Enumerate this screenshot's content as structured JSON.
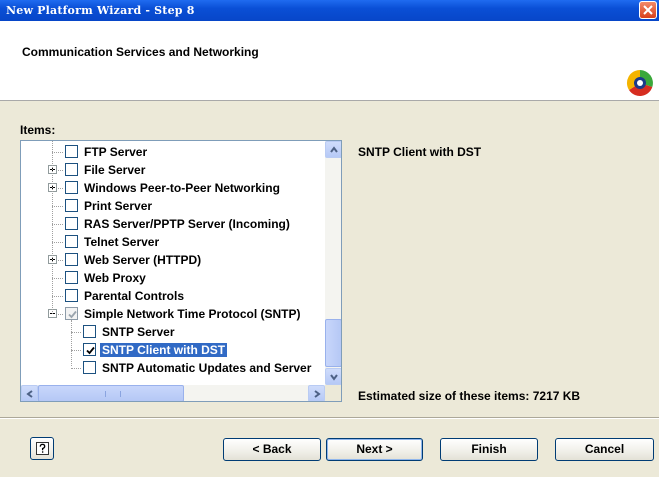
{
  "window": {
    "title": "New Platform Wizard - Step 8"
  },
  "header": {
    "heading": "Communication Services and Networking"
  },
  "items_label": "Items:",
  "tree": [
    {
      "label": "FTP Server",
      "checked": false,
      "expander": null
    },
    {
      "label": "File Server",
      "checked": false,
      "expander": "plus"
    },
    {
      "label": "Windows Peer-to-Peer Networking",
      "checked": false,
      "expander": "plus"
    },
    {
      "label": "Print Server",
      "checked": false,
      "expander": null
    },
    {
      "label": "RAS Server/PPTP Server (Incoming)",
      "checked": false,
      "expander": null
    },
    {
      "label": "Telnet Server",
      "checked": false,
      "expander": null
    },
    {
      "label": "Web Server (HTTPD)",
      "checked": false,
      "expander": "plus"
    },
    {
      "label": "Web Proxy",
      "checked": false,
      "expander": null
    },
    {
      "label": "Parental Controls",
      "checked": false,
      "expander": null
    },
    {
      "label": "Simple Network Time Protocol (SNTP)",
      "checked": "partial",
      "expander": "minus"
    },
    {
      "label": "SNTP Server",
      "checked": false,
      "expander": null,
      "child": true
    },
    {
      "label": "SNTP Client with DST",
      "checked": true,
      "expander": null,
      "child": true,
      "selected": true
    },
    {
      "label": "SNTP Automatic Updates and Server",
      "checked": false,
      "expander": null,
      "child": true
    }
  ],
  "description": "SNTP Client with DST",
  "estimated_size": "Estimated size of these items: 7217 KB",
  "buttons": {
    "back": "< Back",
    "next": "Next >",
    "finish": "Finish",
    "cancel": "Cancel"
  },
  "icons": [
    "close-icon",
    "wizard-logo-icon",
    "help-icon",
    "scroll-up-arrow-icon",
    "scroll-down-arrow-icon",
    "scroll-left-arrow-icon",
    "scroll-right-arrow-icon",
    "checkmark-icon"
  ],
  "colors": {
    "titlebar": "#0a4fd6",
    "selection": "#316ac5",
    "dialog_bg": "#ece9d8"
  }
}
